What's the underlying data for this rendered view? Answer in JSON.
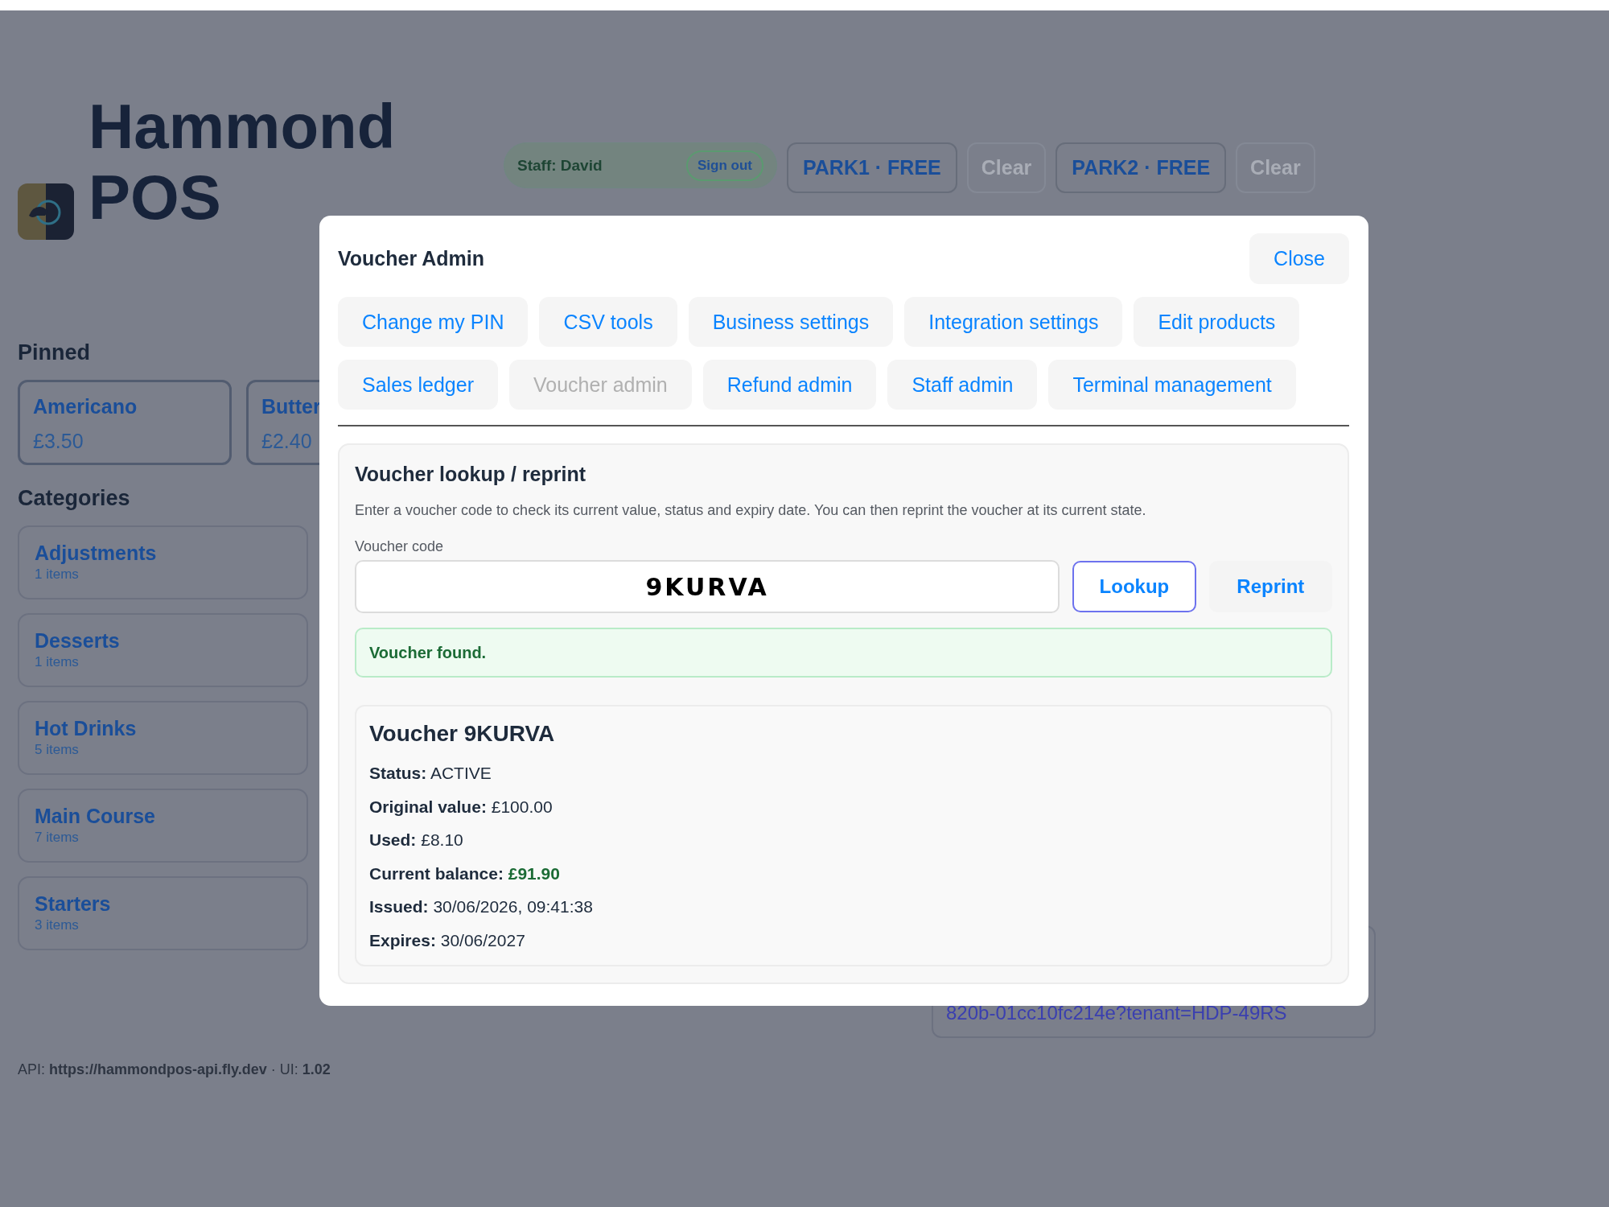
{
  "app": {
    "title": "Hammond POS"
  },
  "top_bar": {
    "staff": "Staff: David",
    "sign_out": "Sign out",
    "parks": [
      {
        "label": "PARK1 · FREE",
        "clear": "Clear"
      },
      {
        "label": "PARK2 · FREE",
        "clear": "Clear"
      }
    ]
  },
  "pinned": {
    "heading": "Pinned",
    "items": [
      {
        "name": "Americano",
        "price": "£3.50"
      },
      {
        "name": "Butter",
        "price": "£2.40"
      }
    ]
  },
  "categories": {
    "heading": "Categories",
    "items": [
      {
        "name": "Adjustments",
        "count": "1 items"
      },
      {
        "name": "Desserts",
        "count": "1 items"
      },
      {
        "name": "Hot Drinks",
        "count": "5 items"
      },
      {
        "name": "Main Course",
        "count": "7 items"
      },
      {
        "name": "Starters",
        "count": "3 items"
      }
    ]
  },
  "background_link": "820b-01cc10fc214e?tenant=HDP-49RS",
  "footer": "API: **https://hammondpos-api.fly.dev** · UI: **1.02**",
  "modal": {
    "title": "Voucher Admin",
    "close": "Close",
    "tab_rows": [
      [
        {
          "label": "Change my PIN",
          "selected": false
        },
        {
          "label": "CSV tools",
          "selected": false
        },
        {
          "label": "Business settings",
          "selected": false
        },
        {
          "label": "Integration settings",
          "selected": false
        },
        {
          "label": "Edit products",
          "selected": false
        }
      ],
      [
        {
          "label": "Sales ledger",
          "selected": false
        },
        {
          "label": "Voucher admin",
          "selected": true
        },
        {
          "label": "Refund admin",
          "selected": false
        },
        {
          "label": "Staff admin",
          "selected": false
        },
        {
          "label": "Terminal management",
          "selected": false
        }
      ]
    ],
    "section": {
      "title": "Voucher lookup / reprint",
      "description": "Enter a voucher code to check its current value, status and expiry date. You can then reprint the voucher at its current state.",
      "field_label": "Voucher code",
      "code": "9KURVA",
      "lookup": "Lookup",
      "reprint": "Reprint",
      "message": "Voucher found.",
      "details": {
        "title": "Voucher 9KURVA",
        "rows": [
          {
            "label": "Status:",
            "value": "ACTIVE",
            "kind": "plain"
          },
          {
            "label": "Original value:",
            "value": "£100.00",
            "kind": "plain"
          },
          {
            "label": "Used:",
            "value": "£8.10",
            "kind": "plain"
          },
          {
            "label": "Current balance:",
            "value": "£91.90",
            "kind": "balance"
          },
          {
            "label": "Issued:",
            "value": "30/06/2026, 09:41:38",
            "kind": "plain"
          },
          {
            "label": "Expires:",
            "value": "30/06/2027",
            "kind": "plain"
          }
        ]
      }
    }
  }
}
